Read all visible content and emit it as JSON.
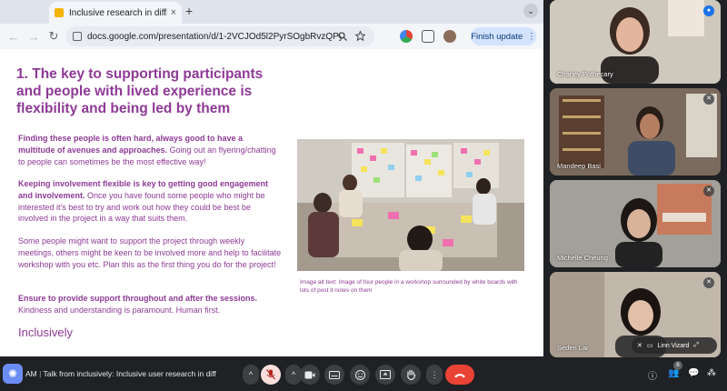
{
  "browser": {
    "tab_title": "Inclusive research in difficu",
    "tab_close": "×",
    "new_tab": "+",
    "tab_menu": "⌄",
    "back": "←",
    "forward": "→",
    "reload": "↻",
    "url": "docs.google.com/presentation/d/1-2VCJOd5l2PyrSOgbRvzQPypvb4i...",
    "finish_update_label": "Finish update",
    "finish_update_dots": "⋮"
  },
  "slide": {
    "title": "1. The key to supporting participants and people with lived experience is flexibility and being led by them",
    "p1_bold": "Finding these people is often hard, always good to have a multitude of avenues and approaches.",
    "p1_text": " Going out an flyering/chatting to people can sometimes be the most effective way!",
    "p2_bold": "Keeping involvement flexible is key to getting good engagement and involvement.",
    "p2_text": " Once you have found some people who might be interested it's best to try and work out how they could be best be involved in the project in a way that suits them.",
    "p3_text": "Some people might want to support the project through weekly meetings, others might be keen to be involved more and help to facilitate workshop with you etc.  Plan this as the first thing you do for the project!",
    "p4_bold": "Ensure to provide support throughout and after the sessions.",
    "p4_text": "Kindness and understanding is paramount. Human first.",
    "subhead": "Inclusively",
    "image_alt": "Image alt text: Image of four people in a workshop surrounded by white boards with lots of post it notes on them"
  },
  "participants": [
    {
      "name": "Charley Pothecary"
    },
    {
      "name": "Mandeep Basi"
    },
    {
      "name": "Michelle Cheung"
    },
    {
      "name": "Seden Lai",
      "self_label": "Linn Vizard"
    }
  ],
  "meet": {
    "time": "AM",
    "meeting_title": "Talk from inclusively: Inclusive user research in diffi...",
    "participant_count": "6"
  },
  "colors": {
    "slide_text": "#8e3a96",
    "meet_bg": "#202124",
    "end_call": "#ea4335"
  }
}
